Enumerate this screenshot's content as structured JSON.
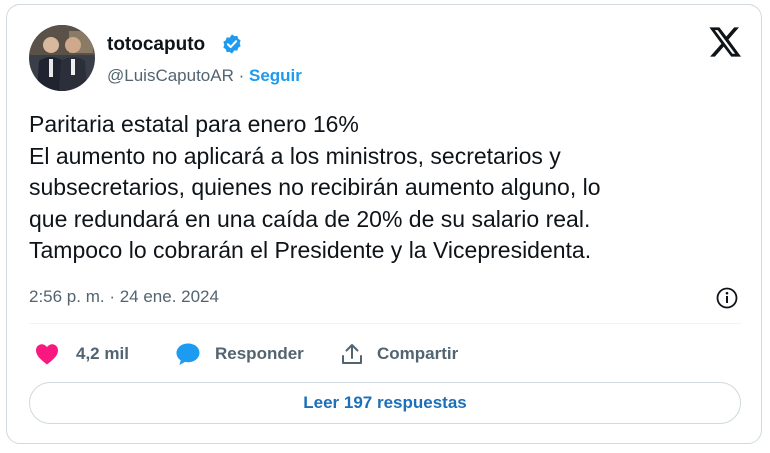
{
  "author": {
    "name": "totocaputo",
    "handle": "@LuisCaputoAR",
    "separator": " · ",
    "follow_label": "Seguir"
  },
  "tweet": {
    "lines": [
      "Paritaria estatal para enero 16%",
      "El aumento no aplicará a los ministros, secretarios y",
      "subsecretarios, quienes no recibirán aumento alguno, lo",
      "que redundará en una caída de 20% de su salario real.",
      "Tampoco lo cobrarán el Presidente y la Vicepresidenta."
    ],
    "timestamp": "2:56 p. m. · 24 ene. 2024"
  },
  "actions": {
    "likes_count": "4,2 mil",
    "reply_label": "Responder",
    "share_label": "Compartir"
  },
  "read_replies_label": "Leer 197 respuestas",
  "colors": {
    "link_blue": "#1d9bf0",
    "like_pink": "#f91880",
    "reply_blue": "#1d9bf0",
    "text_gray": "#536471"
  },
  "icons": [
    "verified-badge-icon",
    "x-logo-icon",
    "info-icon",
    "heart-icon",
    "reply-bubble-icon",
    "share-icon"
  ]
}
